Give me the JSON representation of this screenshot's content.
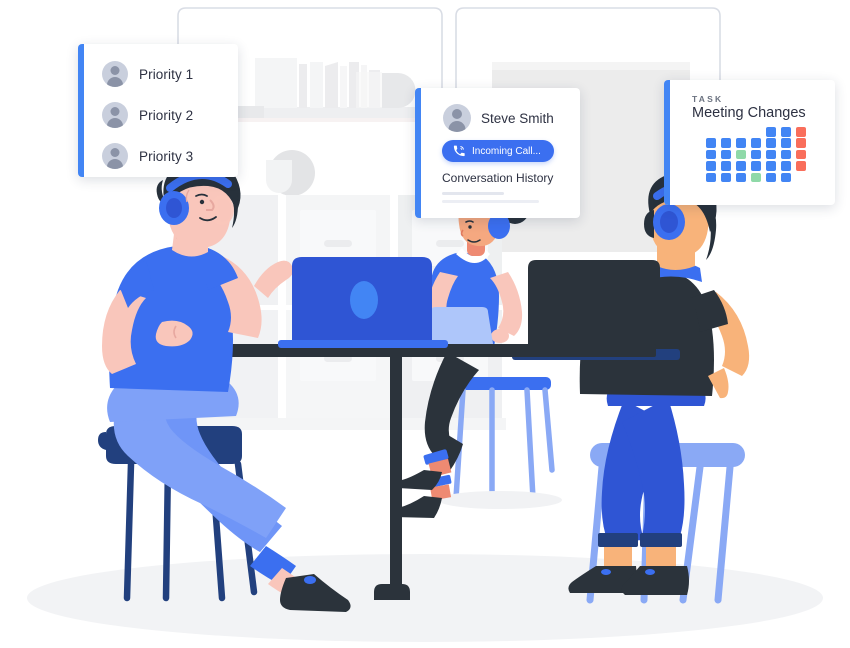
{
  "scene": {
    "title": "Customer support team illustration",
    "description": "Three headset-wearing agents at a high table with laptops, surrounded by floating UI cards"
  },
  "priority_card": {
    "name": "priority-list-card",
    "accent_color": "#4285f4",
    "items": [
      {
        "avatar": "user-avatar-icon",
        "label": "Priority 1"
      },
      {
        "avatar": "user-avatar-icon",
        "label": "Priority 2"
      },
      {
        "avatar": "user-avatar-icon",
        "label": "Priority 3"
      }
    ]
  },
  "contact_card": {
    "name": "contact-card",
    "accent_color": "#4285f4",
    "avatar": "user-avatar-icon",
    "contact_name": "Steve Smith",
    "call_button": {
      "icon": "phone-incoming-icon",
      "label": "Incoming Call...",
      "color": "#3b6ff0"
    },
    "section_title": "Conversation History",
    "placeholder_lines": 2
  },
  "task_card": {
    "name": "task-card",
    "accent_color": "#4285f4",
    "kicker": "TASK",
    "title": "Meeting Changes",
    "legend": {
      "blue": "#4285f4",
      "green": "#8fd9a8",
      "red": "#f96e5b"
    },
    "grid": {
      "rows": 5,
      "cols": 7,
      "cells": [
        [
          "none",
          "none",
          "none",
          "none",
          "blue",
          "blue",
          "red"
        ],
        [
          "blue",
          "blue",
          "blue",
          "blue",
          "blue",
          "blue",
          "red"
        ],
        [
          "blue",
          "blue",
          "green",
          "blue",
          "blue",
          "blue",
          "red"
        ],
        [
          "blue",
          "blue",
          "blue",
          "blue",
          "blue",
          "blue",
          "red"
        ],
        [
          "blue",
          "blue",
          "blue",
          "green",
          "blue",
          "blue",
          "none"
        ]
      ]
    }
  },
  "palette": {
    "background": "#ffffff",
    "primary_blue": "#4285f4",
    "deep_blue": "#2f55d4",
    "navy": "#22407e",
    "light_blue": "#8aa9f5",
    "dark": "#2b333b",
    "skin_light": "#f9c6bb",
    "skin_tan": "#f5a880",
    "skin_warm": "#f8b37a",
    "hair": "#27313b",
    "floor_shadow": "#f1f2f5",
    "furniture_gray": "#f0f1f3",
    "connector_line": "#d6dae3"
  },
  "scene_elements": {
    "people": [
      {
        "name": "agent-left",
        "pose": "side-profile-typing",
        "shirt": "#3b6ff0",
        "pants": "#6f95f7"
      },
      {
        "name": "agent-middle",
        "pose": "facing-forward-laptop",
        "shirt": "#3b6ff0",
        "pants": "#2b333b"
      },
      {
        "name": "agent-right",
        "pose": "back-view",
        "shirt": "#2b333b",
        "pants": "#2f55d4"
      }
    ],
    "furniture": [
      "high-table",
      "stool-left",
      "stool-middle",
      "stool-right",
      "bookshelf",
      "storage-boxes"
    ],
    "devices": [
      "laptop-blue",
      "laptop-light",
      "laptop-dark"
    ]
  }
}
